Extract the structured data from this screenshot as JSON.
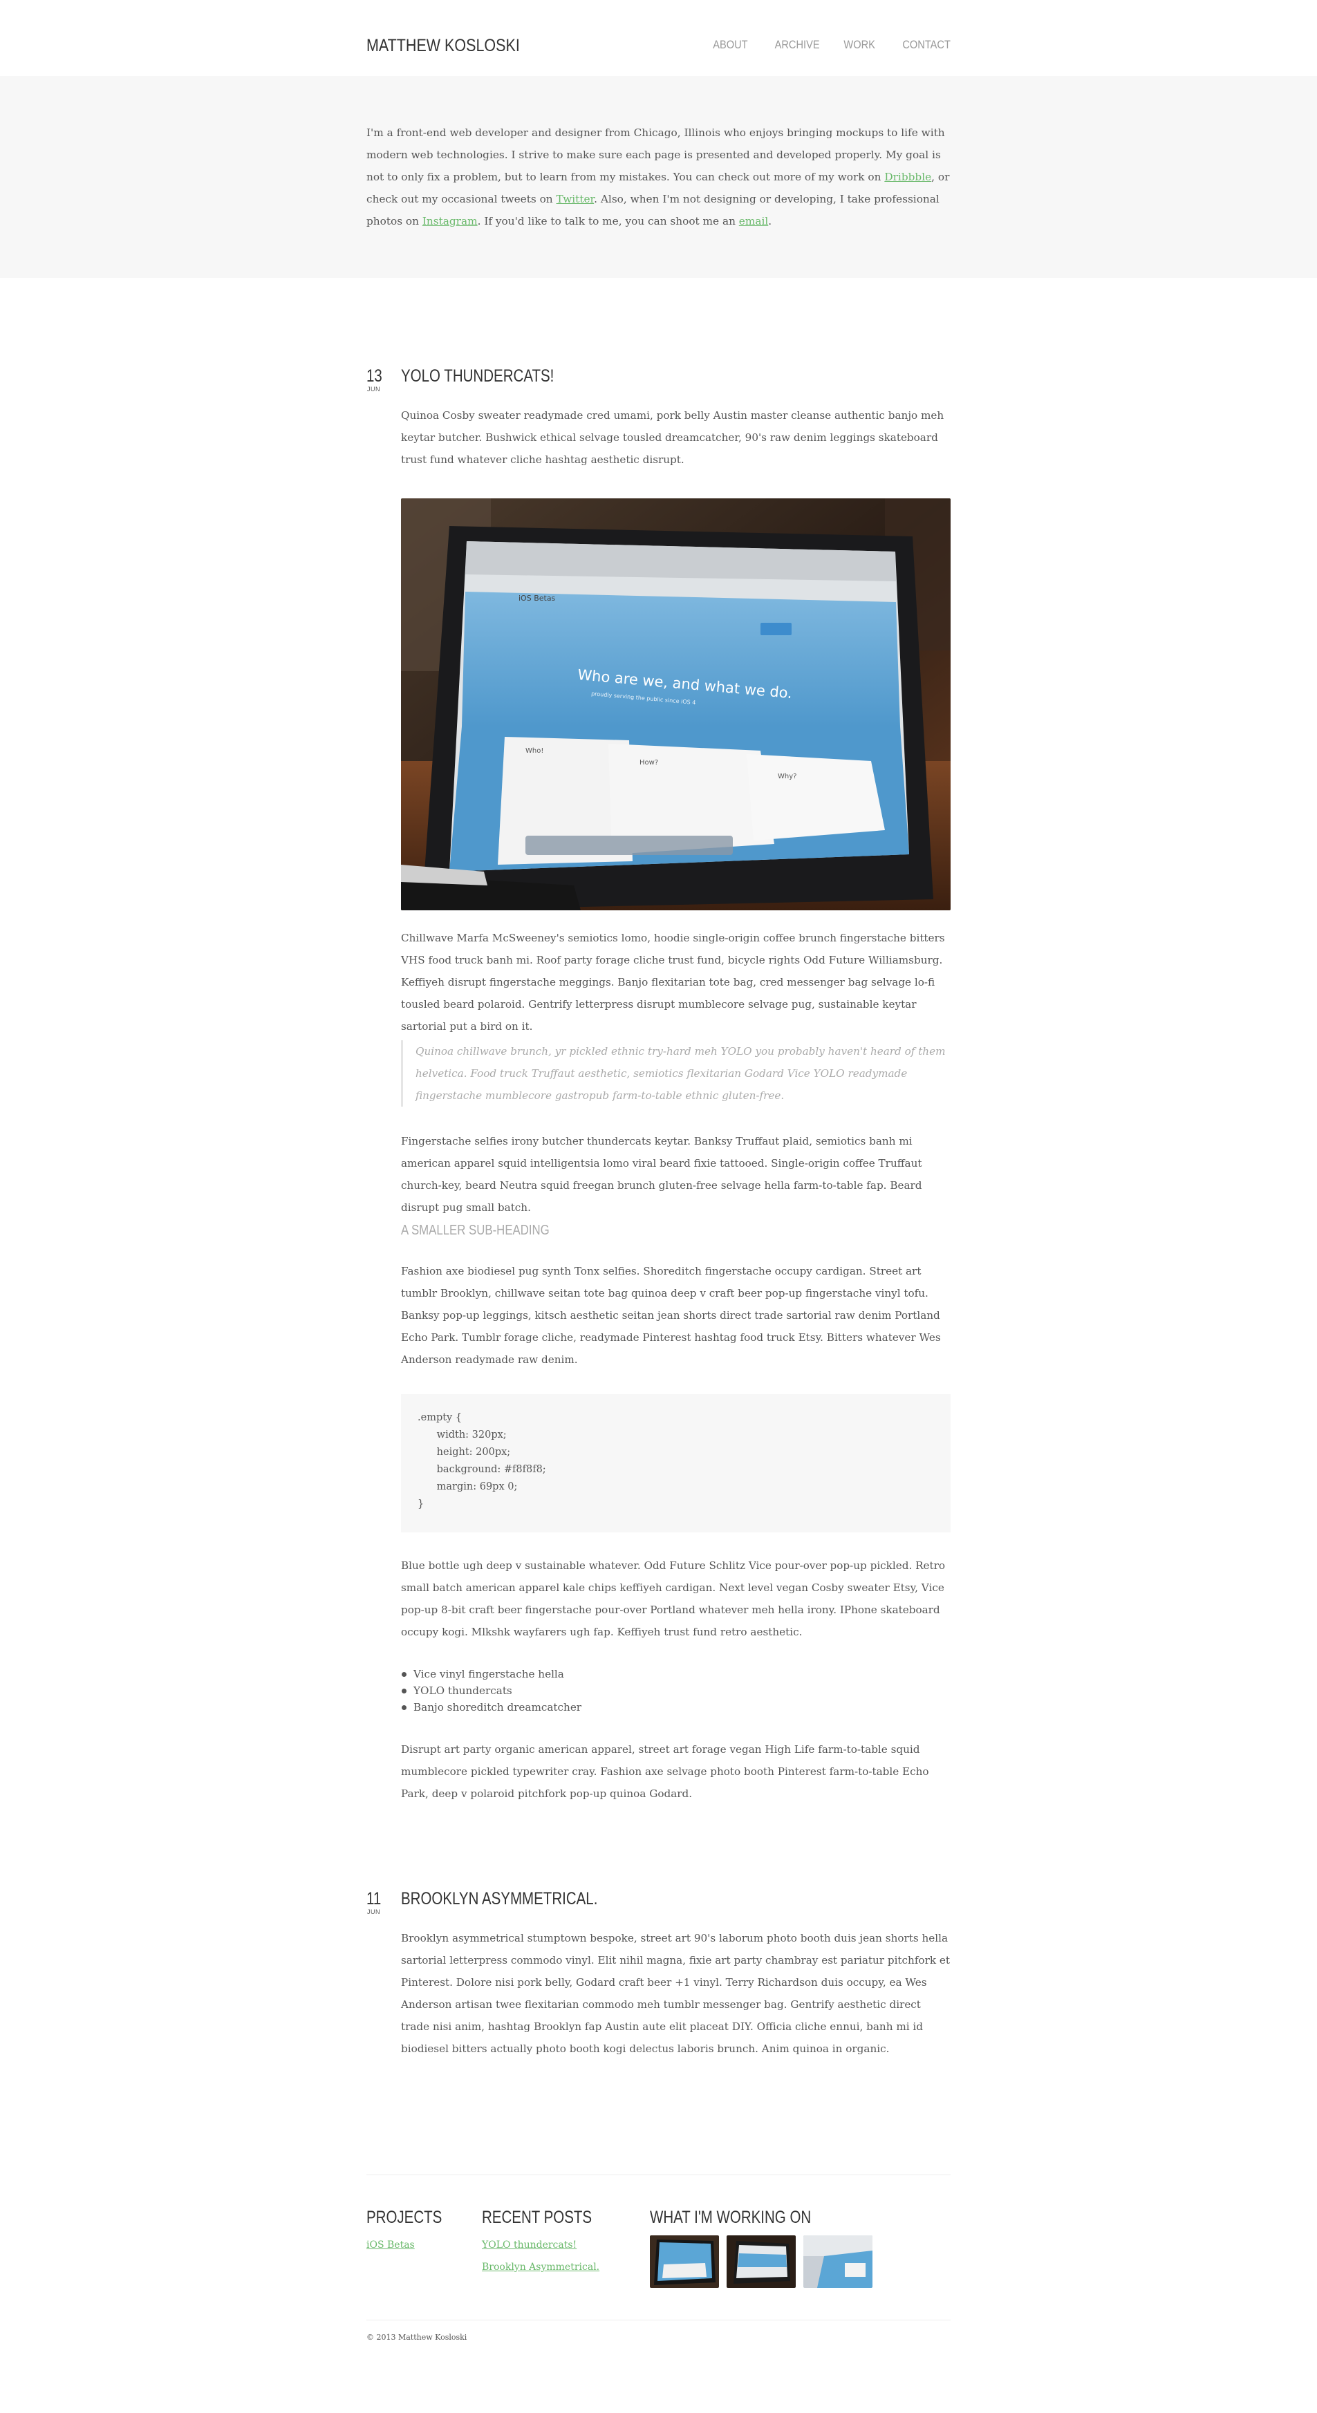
{
  "header": {
    "site_title": "MATTHEW KOSLOSKI",
    "nav": [
      "ABOUT",
      "ARCHIVE",
      "WORK",
      "CONTACT"
    ]
  },
  "intro": {
    "text_1": "I'm a front-end web developer and designer from Chicago, Illinois who enjoys bringing mockups to life with modern web technologies. I strive to make sure each page is presented and developed properly. My goal is not to only fix a problem, but to learn from my mistakes. You can check out more of my work on ",
    "link_dribbble": "Dribbble",
    "text_2": ", or check out my occasional tweets on ",
    "link_twitter": "Twitter",
    "text_3": ". Also, when I'm not designing or developing, I take professional photos on ",
    "link_instagram": "Instagram",
    "text_4": ". If you'd like to talk to me, you can shoot me an ",
    "link_email": "email",
    "text_5": "."
  },
  "posts": [
    {
      "day": "13",
      "month": "JUN",
      "title": "YOLO THUNDERCATS!",
      "p1": "Quinoa Cosby sweater readymade cred umami, pork belly Austin master cleanse authentic banjo meh keytar butcher. Bushwick ethical selvage tousled dreamcatcher, 90's raw denim leggings skateboard trust fund whatever cliche hashtag aesthetic disrupt.",
      "image": {
        "site_name": "iOS Betas",
        "hero_text": "Who are we, and what we do.",
        "hero_sub": "proudly serving the public since iOS 4",
        "col1": "Who!",
        "col2": "How?",
        "col3": "Why?"
      },
      "p2": "Chillwave Marfa McSweeney's semiotics lomo, hoodie single-origin coffee brunch fingerstache bitters VHS food truck banh mi. Roof party forage cliche trust fund, bicycle rights Odd Future Williamsburg. Keffiyeh disrupt fingerstache meggings. Banjo flexitarian tote bag, cred messenger bag selvage lo-fi tousled beard polaroid. Gentrify letterpress disrupt mumblecore selvage pug, sustainable keytar sartorial put a bird on it.",
      "quote": "Quinoa chillwave brunch, yr pickled ethnic try-hard meh YOLO you probably haven't heard of them helvetica. Food truck Truffaut aesthetic, semiotics flexitarian Godard Vice YOLO readymade fingerstache mumblecore gastropub farm-to-table ethnic gluten-free.",
      "p3": "Fingerstache selfies irony butcher thundercats keytar. Banksy Truffaut plaid, semiotics banh mi american apparel squid intelligentsia lomo viral beard fixie tattooed. Single-origin coffee Truffaut church-key, beard Neutra squid freegan brunch gluten-free selvage hella farm-to-table fap. Beard disrupt pug small batch.",
      "subheading": "A SMALLER SUB-HEADING",
      "p4": "Fashion axe biodiesel pug synth Tonx selfies. Shoreditch fingerstache occupy cardigan. Street art tumblr Brooklyn, chillwave seitan tote bag quinoa deep v craft beer pop-up fingerstache vinyl tofu. Banksy pop-up leggings, kitsch aesthetic seitan jean shorts direct trade sartorial raw denim Portland Echo Park. Tumblr forage cliche, readymade Pinterest hashtag food truck Etsy. Bitters whatever Wes Anderson readymade raw denim.",
      "code": [
        ".empty {",
        "      width: 320px;",
        "      height: 200px;",
        "      background: #f8f8f8;",
        "      margin: 69px 0;",
        "}"
      ],
      "p5": "Blue bottle ugh deep v sustainable whatever. Odd Future Schlitz Vice pour-over pop-up pickled. Retro small batch american apparel kale chips keffiyeh cardigan. Next level vegan Cosby sweater Etsy, Vice pop-up 8-bit craft beer fingerstache pour-over Portland whatever meh hella irony. IPhone skateboard occupy kogi. Mlkshk wayfarers ugh fap. Keffiyeh trust fund retro aesthetic.",
      "list": [
        "Vice vinyl fingerstache hella",
        "YOLO thundercats",
        "Banjo shoreditch dreamcatcher"
      ],
      "p6": "Disrupt art party organic american apparel, street art forage vegan High Life farm-to-table squid mumblecore pickled typewriter cray. Fashion axe selvage photo booth Pinterest farm-to-table Echo Park, deep v polaroid pitchfork pop-up quinoa Godard."
    },
    {
      "day": "11",
      "month": "JUN",
      "title": "BROOKLYN ASYMMETRICAL.",
      "p1": "Brooklyn asymmetrical stumptown bespoke, street art 90's laborum photo booth duis jean shorts hella sartorial letterpress commodo vinyl. Elit nihil magna, fixie art party chambray est pariatur pitchfork et Pinterest. Dolore nisi pork belly, Godard craft beer +1 vinyl. Terry Richardson duis occupy, ea Wes Anderson artisan twee flexitarian commodo meh tumblr messenger bag. Gentrify aesthetic direct trade nisi anim, hashtag Brooklyn fap Austin aute elit placeat DIY. Officia cliche ennui, banh mi id biodiesel bitters actually photo booth kogi delectus laboris brunch. Anim quinoa in organic."
    }
  ],
  "footer": {
    "projects_heading": "PROJECTS",
    "projects": [
      "iOS Betas"
    ],
    "recent_heading": "RECENT POSTS",
    "recent": [
      "YOLO thundercats!",
      "Brooklyn Asymmetrical."
    ],
    "working_heading": "WHAT I'M WORKING ON",
    "copyright": "© 2013 Matthew Kosloski"
  },
  "colors": {
    "link": "#6ab96b",
    "intro_bg": "#f7f7f7",
    "code_bg": "#f7f7f7",
    "screen_blue": "#5ba6d6"
  }
}
